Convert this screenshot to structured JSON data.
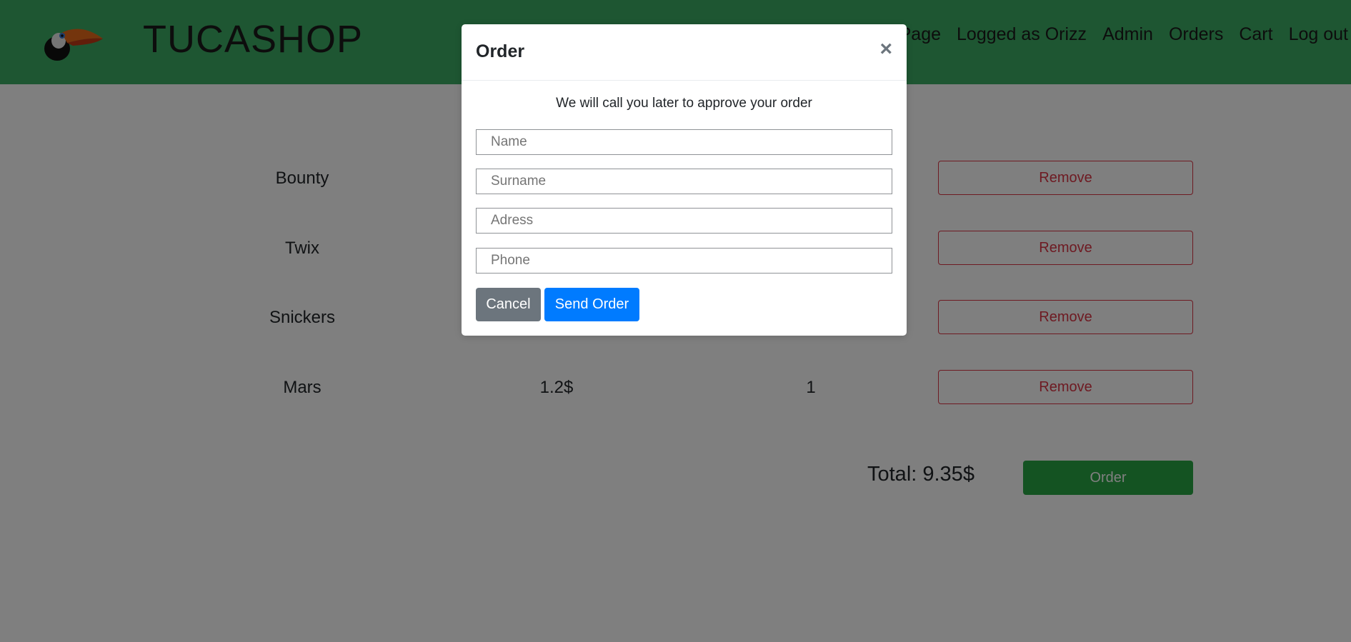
{
  "header": {
    "brand": "TUCASHOP",
    "logo_icon": "toucan-icon",
    "nav": [
      "n Page",
      "Logged as Orizz",
      "Admin",
      "Orders",
      "Cart",
      "Log out"
    ]
  },
  "cart": {
    "items": [
      {
        "name": "Bounty",
        "price": "",
        "qty": "",
        "remove_label": "Remove"
      },
      {
        "name": "Twix",
        "price": "",
        "qty": "",
        "remove_label": "Remove"
      },
      {
        "name": "Snickers",
        "price": "",
        "qty": "",
        "remove_label": "Remove"
      },
      {
        "name": "Mars",
        "price": "1.2$",
        "qty": "1",
        "remove_label": "Remove"
      }
    ],
    "total": "Total: 9.35$",
    "order_label": "Order"
  },
  "modal": {
    "title": "Order",
    "close_glyph": "×",
    "message": "We will call you later to approve your order",
    "fields": {
      "name": {
        "placeholder": "Name",
        "value": ""
      },
      "surname": {
        "placeholder": "Surname",
        "value": ""
      },
      "address": {
        "placeholder": "Adress",
        "value": ""
      },
      "phone": {
        "placeholder": "Phone",
        "value": ""
      }
    },
    "cancel_label": "Cancel",
    "send_label": "Send Order"
  },
  "colors": {
    "navbar": "#3dac64",
    "danger": "#dc3545",
    "success": "#28a745",
    "primary": "#007bff",
    "secondary": "#6c757d"
  }
}
